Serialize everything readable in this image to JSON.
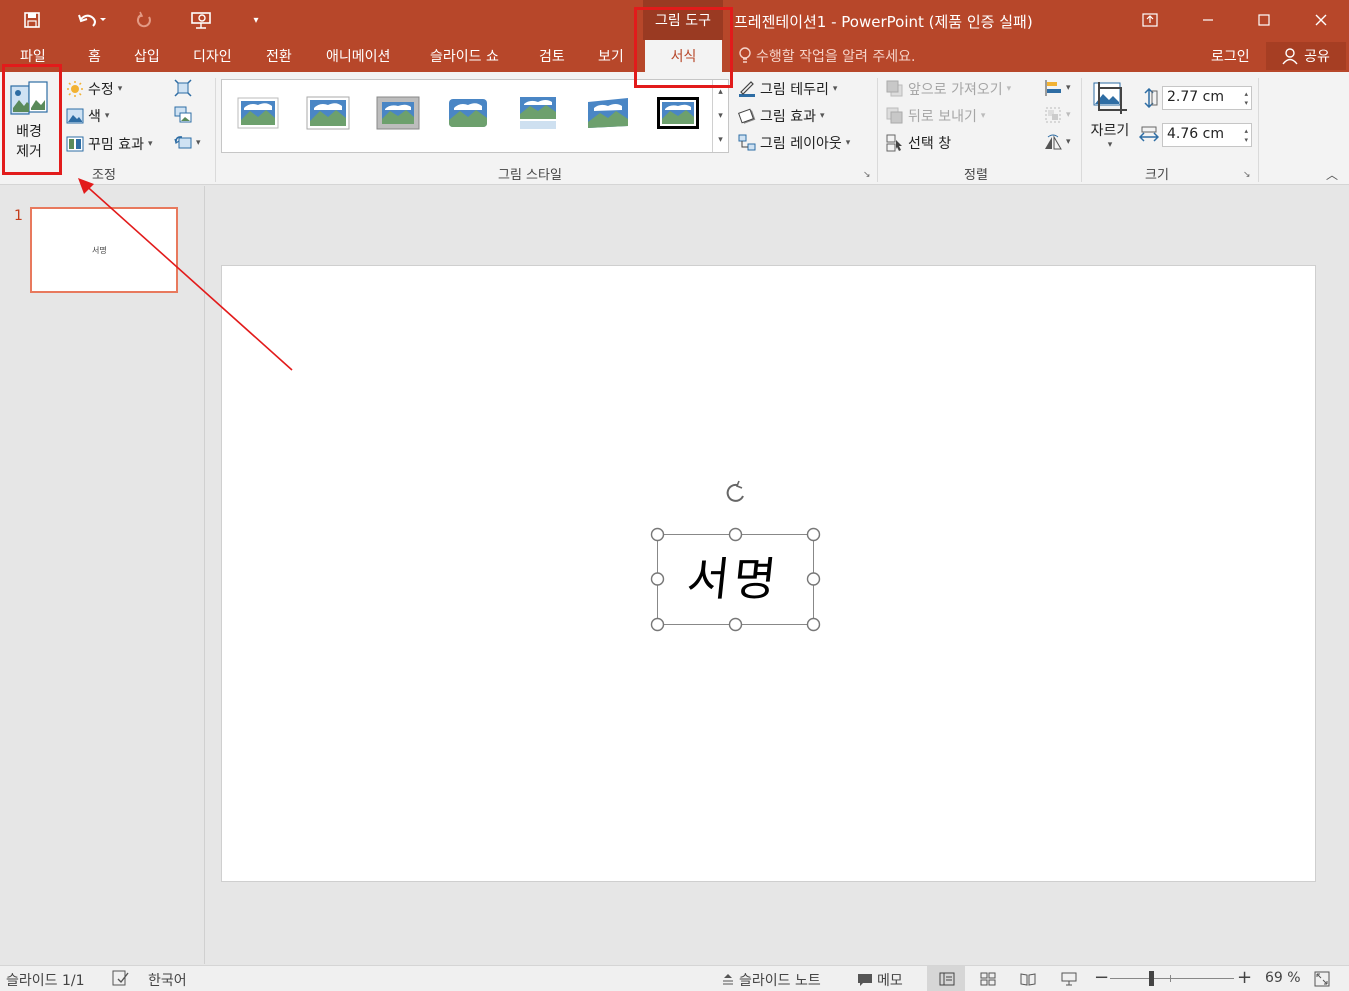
{
  "title_bar": {
    "document_title": "프레젠테이션1 - PowerPoint (제품 인증 실패)",
    "context_tab_header": "그림 도구",
    "quick_access": [
      "save-icon",
      "undo-icon",
      "redo-icon",
      "present-icon",
      "customize-icon"
    ],
    "window_buttons": [
      "ribbon-display-icon",
      "minimize-icon",
      "maximize-icon",
      "close-icon"
    ]
  },
  "tabs": {
    "items": [
      "파일",
      "홈",
      "삽입",
      "디자인",
      "전환",
      "애니메이션",
      "슬라이드 쇼",
      "검토",
      "보기"
    ],
    "active_context_tab": "서식",
    "tell_me_placeholder": "수행할 작업을 알려 주세요.",
    "sign_in": "로그인",
    "share": "공유"
  },
  "ribbon": {
    "adjust": {
      "label": "조정",
      "remove_background_line1": "배경",
      "remove_background_line2": "제거",
      "corrections": "수정",
      "color": "색",
      "artistic_effects": "꾸밈 효과"
    },
    "picture_styles": {
      "label": "그림 스타일",
      "border": "그림 테두리",
      "effects": "그림 효과",
      "layout": "그림 레이아웃"
    },
    "arrange": {
      "label": "정렬",
      "bring_forward": "앞으로 가져오기",
      "send_backward": "뒤로 보내기",
      "selection_pane": "선택 창"
    },
    "size": {
      "label": "크기",
      "crop": "자르기",
      "height": "2.77 cm",
      "width": "4.76 cm"
    }
  },
  "thumbnails": {
    "slide_number": "1",
    "slide_text": "서명"
  },
  "slide": {
    "picture_text": "서명"
  },
  "status_bar": {
    "slide_info": "슬라이드 1/1",
    "language": "한국어",
    "notes": "슬라이드 노트",
    "comments": "메모",
    "zoom": "69 %"
  },
  "colors": {
    "accent": "#b7472a",
    "highlight": "#e21b1b"
  }
}
